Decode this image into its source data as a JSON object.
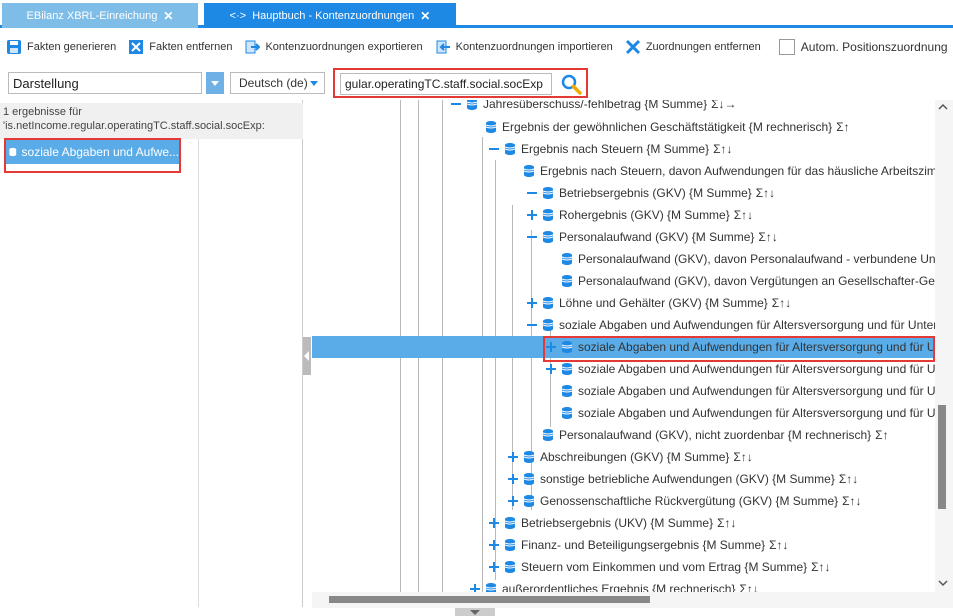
{
  "tabs": [
    {
      "label": "EBilanz XBRL-Einreichung",
      "close": "✕"
    },
    {
      "icon": "<·>",
      "label": "Hauptbuch - Kontenzuordnungen",
      "close": "✕"
    }
  ],
  "toolbar": {
    "generate": "Fakten generieren",
    "remove": "Fakten entfernen",
    "export": "Kontenzuordnungen exportieren",
    "import": "Kontenzuordnungen importieren",
    "clear": "Zuordnungen entfernen",
    "auto": "Autom. Positionszuordnung"
  },
  "filter": {
    "view": "Darstellung",
    "language": "Deutsch (de)",
    "search": "gular.operatingTC.staff.social.socExp"
  },
  "results": {
    "count": "1 ergebnisse für",
    "query": "'is.netIncome.regular.operatingTC.staff.social.socExp:",
    "item": "soziale Abgaben und Aufwe..."
  },
  "tree": [
    {
      "label": "Jahresüberschuss/-fehlbetrag {M Summe}",
      "marker": "Σ↓→",
      "exp": "minus"
    },
    {
      "label": "Ergebnis der gewöhnlichen Geschäftstätigkeit {M rechnerisch}",
      "marker": "Σ↑",
      "exp": "none"
    },
    {
      "label": "Ergebnis nach Steuern {M Summe}",
      "marker": "Σ↑↓",
      "exp": "minus"
    },
    {
      "label": "Ergebnis nach Steuern, davon Aufwendungen für das häusliche Arbeitszimmer",
      "marker": "",
      "exp": "none"
    },
    {
      "label": "Betriebsergebnis (GKV) {M Summe}",
      "marker": "Σ↑↓",
      "exp": "minus"
    },
    {
      "label": "Rohergebnis (GKV) {M Summe}",
      "marker": "Σ↑↓",
      "exp": "plus"
    },
    {
      "label": "Personalaufwand (GKV) {M Summe}",
      "marker": "Σ↑↓",
      "exp": "minus"
    },
    {
      "label": "Personalaufwand (GKV), davon Personalaufwand - verbundene Unternehmen",
      "marker": "",
      "exp": "none"
    },
    {
      "label": "Personalaufwand (GKV), davon Vergütungen an Gesellschafter-Geschäftsführer",
      "marker": "",
      "exp": "none"
    },
    {
      "label": "Löhne und Gehälter (GKV) {M Summe}",
      "marker": "Σ↑↓",
      "exp": "plus"
    },
    {
      "label": "soziale Abgaben und Aufwendungen für Altersversorgung und für Unterstützung",
      "marker": "",
      "exp": "minus"
    },
    {
      "label": "soziale Abgaben und Aufwendungen für Altersversorgung und für Unterstützung",
      "marker": "",
      "exp": "plus",
      "selected": true
    },
    {
      "label": "soziale Abgaben und Aufwendungen für Altersversorgung und für Unterstützung",
      "marker": "",
      "exp": "plus"
    },
    {
      "label": "soziale Abgaben und Aufwendungen für Altersversorgung und für Unterstützung",
      "marker": "",
      "exp": "none"
    },
    {
      "label": "soziale Abgaben und Aufwendungen für Altersversorgung und für Unterstützung",
      "marker": "",
      "exp": "none"
    },
    {
      "label": "Personalaufwand (GKV), nicht zuordenbar {M rechnerisch}",
      "marker": "Σ↑",
      "exp": "none"
    },
    {
      "label": "Abschreibungen (GKV) {M Summe}",
      "marker": "Σ↑↓",
      "exp": "plus"
    },
    {
      "label": "sonstige betriebliche Aufwendungen (GKV) {M Summe}",
      "marker": "Σ↑↓",
      "exp": "plus"
    },
    {
      "label": "Genossenschaftliche Rückvergütung (GKV) {M Summe}",
      "marker": "Σ↑↓",
      "exp": "plus"
    },
    {
      "label": "Betriebsergebnis (UKV) {M Summe}",
      "marker": "Σ↑↓",
      "exp": "plus"
    },
    {
      "label": "Finanz- und Beteiligungsergebnis {M Summe}",
      "marker": "Σ↑↓",
      "exp": "plus"
    },
    {
      "label": "Steuern vom Einkommen und vom Ertrag {M Summe}",
      "marker": "Σ↑↓",
      "exp": "plus"
    },
    {
      "label": "außerordentliches Ergebnis {M rechnerisch}",
      "marker": "Σ↑↓",
      "exp": "plus"
    }
  ],
  "colors": {
    "accent": "#1e88e5",
    "selection": "#5aace8",
    "highlight_border": "#e53935"
  }
}
